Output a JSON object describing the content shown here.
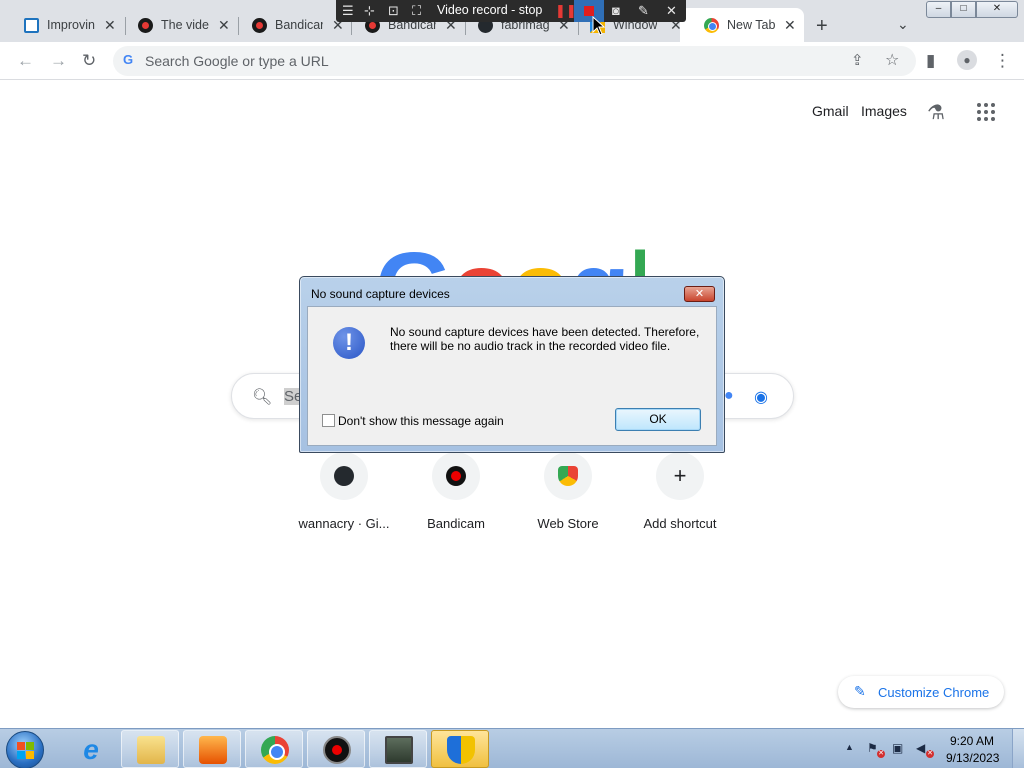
{
  "browser": {
    "tabs": [
      {
        "title": "Improvin",
        "favicon": "page-icon"
      },
      {
        "title": "The vide",
        "favicon": "bandicam-icon"
      },
      {
        "title": "Bandicar",
        "favicon": "bandicam-icon"
      },
      {
        "title": "Bandicar",
        "favicon": "bandicam-icon"
      },
      {
        "title": "fabrimag",
        "favicon": "github-icon"
      },
      {
        "title": "Window",
        "favicon": "windows-icon"
      },
      {
        "title": "New Tab",
        "favicon": "chrome-icon"
      }
    ],
    "new_tab_symbol": "+",
    "omnibox_placeholder": "Search Google or type a URL",
    "window_controls": {
      "minimize": "–",
      "maximize": "□",
      "close": "✕"
    }
  },
  "recorder_bar": {
    "title": "Video record - stop",
    "stop_color": "#e01e1e",
    "active_bg": "#2f6fb7"
  },
  "ntp": {
    "gmail": "Gmail",
    "images": "Images",
    "logo_letters": [
      "G",
      "o",
      "o",
      "g",
      "l",
      "e"
    ],
    "logo_colors": [
      "#4285f4",
      "#ea4335",
      "#fbbc05",
      "#4285f4",
      "#34a853",
      "#ea4335"
    ],
    "search_placeholder": "Se",
    "shortcuts": [
      {
        "label": "wannacry · Gi...",
        "icon": "github-icon"
      },
      {
        "label": "Bandicam",
        "icon": "bandicam-icon"
      },
      {
        "label": "Web Store",
        "icon": "webstore-icon"
      },
      {
        "label": "Add shortcut",
        "icon": "plus-icon"
      }
    ],
    "customize_label": "Customize Chrome"
  },
  "dialog": {
    "title": "No sound capture devices",
    "message": "No sound capture devices have been detected. Therefore, there will be no audio track in the recorded video file.",
    "checkbox_label": "Don't show this message again",
    "checkbox_checked": false,
    "ok_label": "OK",
    "close_symbol": "✕",
    "info_symbol": "!"
  },
  "taskbar": {
    "time": "9:20 AM",
    "date": "9/13/2023",
    "apps": [
      "internet-explorer-icon",
      "folder-icon",
      "media-player-icon",
      "chrome-icon",
      "bandicam-icon",
      "monitor-icon",
      "uac-shield-icon"
    ]
  }
}
